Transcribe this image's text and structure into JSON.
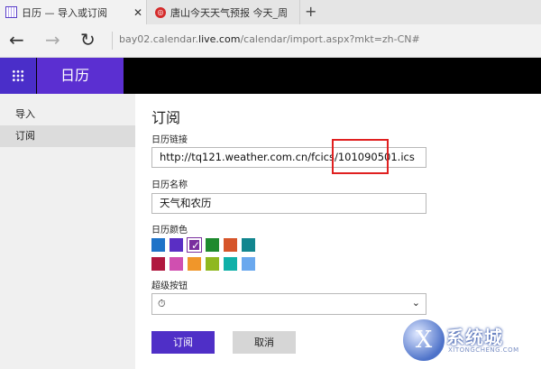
{
  "browser": {
    "tabs": [
      {
        "label": "日历 — 导入或订阅",
        "icon": "calendar-icon"
      },
      {
        "label": "唐山今天天气预报 今天_周",
        "icon": "weather-site-icon"
      }
    ],
    "close_glyph": "✕",
    "new_tab_glyph": "+",
    "back_glyph": "←",
    "forward_glyph": "→",
    "refresh_glyph": "↻",
    "url_prefix": "bay02.calendar.",
    "url_domain": "live.com",
    "url_path": "/calendar/import.aspx?mkt=zh-CN#"
  },
  "app": {
    "title": "日历"
  },
  "sidebar": {
    "items": [
      {
        "label": "导入"
      },
      {
        "label": "订阅",
        "selected": true
      }
    ]
  },
  "form": {
    "heading": "订阅",
    "url_label": "日历链接",
    "url_value": "http://tq121.weather.com.cn/fcics/101090501.ics",
    "name_label": "日历名称",
    "name_value": "天气和农历",
    "color_label": "日历颜色",
    "colors": [
      "#1e73c8",
      "#5a2ec4",
      "#7a2f9e",
      "#1e8a2e",
      "#d6552a",
      "#12868f",
      "#b0183f",
      "#d04fb0",
      "#f0962a",
      "#8fb820",
      "#10b0a8",
      "#6aa8ee"
    ],
    "selected_color_index": 2,
    "charm_label": "超级按钮",
    "charm_icon": "stopwatch-icon",
    "charm_glyph": "⏱",
    "chevron_glyph": "⌄",
    "subscribe_label": "订阅",
    "cancel_label": "取消"
  },
  "watermark": {
    "logo_glyph": "X",
    "text": "系统城",
    "sub": "XITONGCHENG.COM"
  }
}
